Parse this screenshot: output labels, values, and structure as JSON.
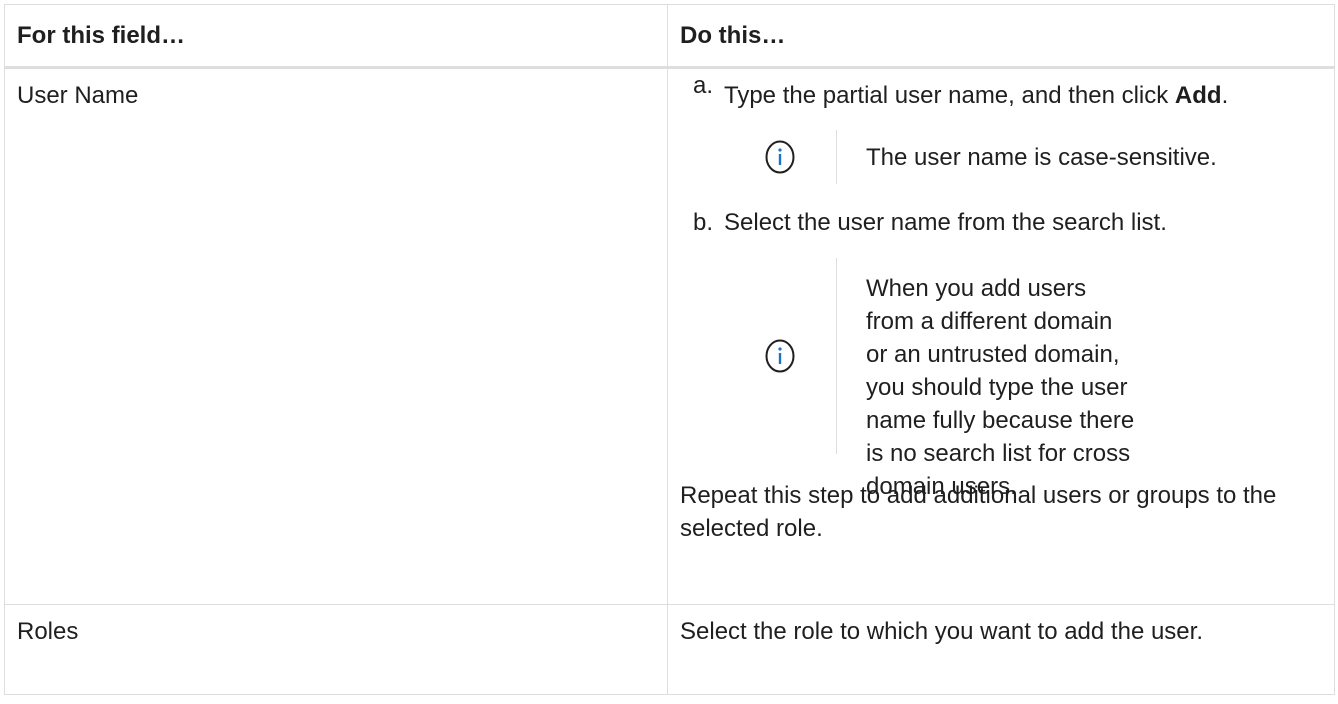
{
  "table": {
    "headers": [
      "For this field…",
      "Do this…"
    ],
    "rows": {
      "user_name": {
        "field": "User Name",
        "step_a": {
          "marker": "a.",
          "text_before": "Type the partial user name, and then click ",
          "bold": "Add",
          "text_after": "."
        },
        "note_1": {
          "icon": "info-circle-icon",
          "text": "The user name is case-sensitive."
        },
        "step_b": {
          "marker": "b.",
          "text": "Select the user name from the search list."
        },
        "note_2": {
          "icon": "info-circle-icon",
          "text": "When you add users from a different domain or an untrusted domain, you should type the user name fully because there is no search list for cross domain users."
        },
        "repeat": "Repeat this step to add additional users or groups to the selected role."
      },
      "roles": {
        "field": "Roles",
        "text": "Select the role to which you want to add the user."
      }
    }
  },
  "colors": {
    "icon_blue": "#1a73c9",
    "border": "#dedede",
    "text": "#1f1f1f"
  }
}
